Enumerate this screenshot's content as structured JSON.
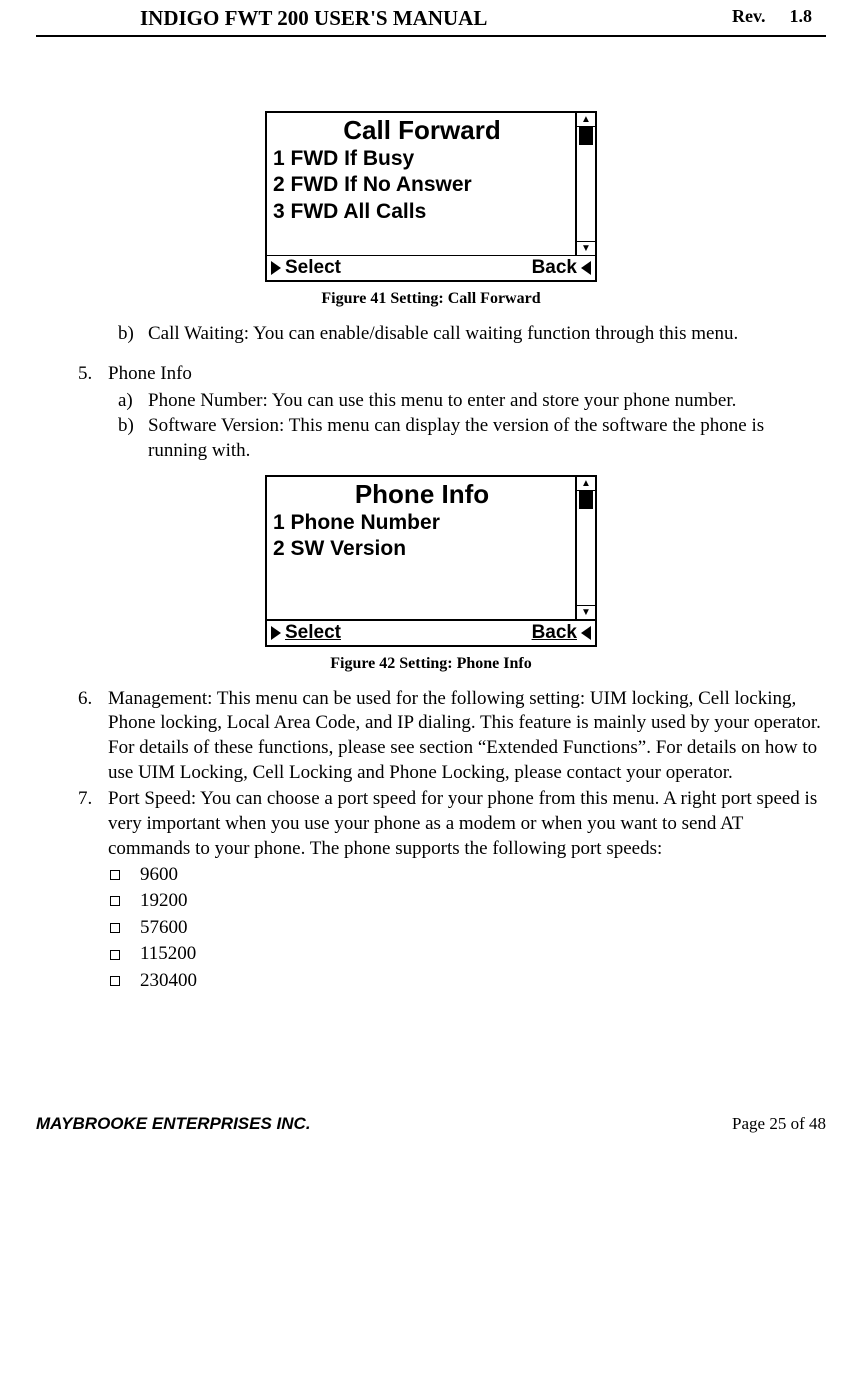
{
  "header": {
    "title": "INDIGO FWT 200 USER'S MANUAL",
    "rev_label": "Rev.",
    "rev_value": "1.8"
  },
  "screen1": {
    "title": "Call Forward",
    "items": [
      "1 FWD If Busy",
      "2 FWD If No Answer",
      "3 FWD All Calls"
    ],
    "softkey_left": "Select",
    "softkey_right": "Back",
    "caption": "Figure 41 Setting: Call Forward"
  },
  "body": {
    "item_b_label": "b)",
    "item_b_text": "Call Waiting: You can enable/disable call waiting function through this menu.",
    "item5_label": "5.",
    "item5_text": "Phone Info",
    "item5a_label": "a)",
    "item5a_text": "Phone Number:  You can use this menu to enter and store your phone number.",
    "item5b_label": "b)",
    "item5b_text": "Software Version: This menu can display the version of the software the phone is running with."
  },
  "screen2": {
    "title": "Phone Info",
    "items": [
      "1 Phone Number",
      "2 SW Version"
    ],
    "softkey_left": "Select",
    "softkey_right": "Back",
    "caption": "Figure 42 Setting: Phone Info"
  },
  "body2": {
    "item6_label": "6.",
    "item6_text": "Management: This menu can be used for the following setting: UIM locking, Cell locking, Phone locking, Local Area Code,  and IP dialing. This feature is mainly used by your operator. For details of these functions, please see section “Extended Functions”. For details on how to use UIM Locking, Cell Locking and Phone Locking, please contact your operator.",
    "item7_label": "7.",
    "item7_text": "Port Speed: You can choose a port speed for your phone from this menu. A right  port speed is very important when you use your phone as a modem or when you want to send AT commands to your phone.  The phone supports the following port speeds:",
    "speeds": [
      "9600",
      "19200",
      "57600",
      "115200",
      "230400"
    ]
  },
  "footer": {
    "company": "MAYBROOKE ENTERPRISES INC.",
    "page": "Page 25 of 48"
  }
}
